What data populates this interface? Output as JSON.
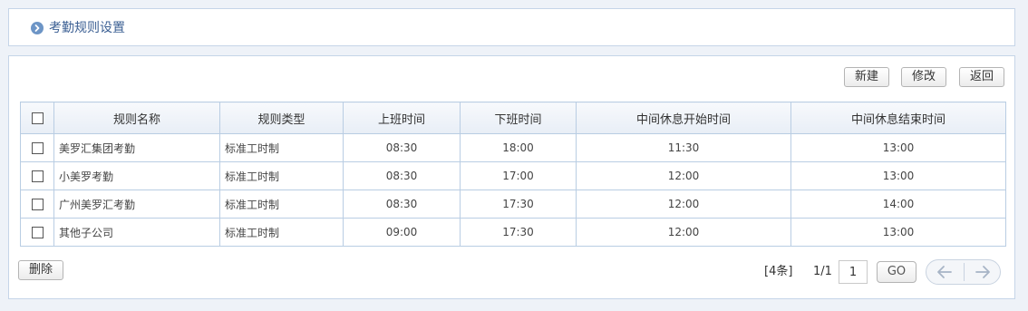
{
  "header": {
    "title": "考勤规则设置"
  },
  "toolbar": {
    "new_label": "新建",
    "edit_label": "修改",
    "back_label": "返回"
  },
  "table": {
    "columns": [
      "规则名称",
      "规则类型",
      "上班时间",
      "下班时间",
      "中间休息开始时间",
      "中间休息结束时间"
    ],
    "rows": [
      {
        "name": "美罗汇集团考勤",
        "type": "标准工时制",
        "start": "08:30",
        "end": "18:00",
        "break_start": "11:30",
        "break_end": "13:00"
      },
      {
        "name": "小美罗考勤",
        "type": "标准工时制",
        "start": "08:30",
        "end": "17:00",
        "break_start": "12:00",
        "break_end": "13:00"
      },
      {
        "name": "广州美罗汇考勤",
        "type": "标准工时制",
        "start": "08:30",
        "end": "17:30",
        "break_start": "12:00",
        "break_end": "14:00"
      },
      {
        "name": "其他子公司",
        "type": "标准工时制",
        "start": "09:00",
        "end": "17:30",
        "break_start": "12:00",
        "break_end": "13:00"
      }
    ]
  },
  "footer": {
    "delete_label": "删除",
    "count_text": "[4条]",
    "page_text": "1/1",
    "page_input_value": "1",
    "go_label": "GO"
  },
  "icons": {
    "title": "chevron-circle-icon",
    "prev": "arrow-left-icon",
    "next": "arrow-right-icon"
  }
}
